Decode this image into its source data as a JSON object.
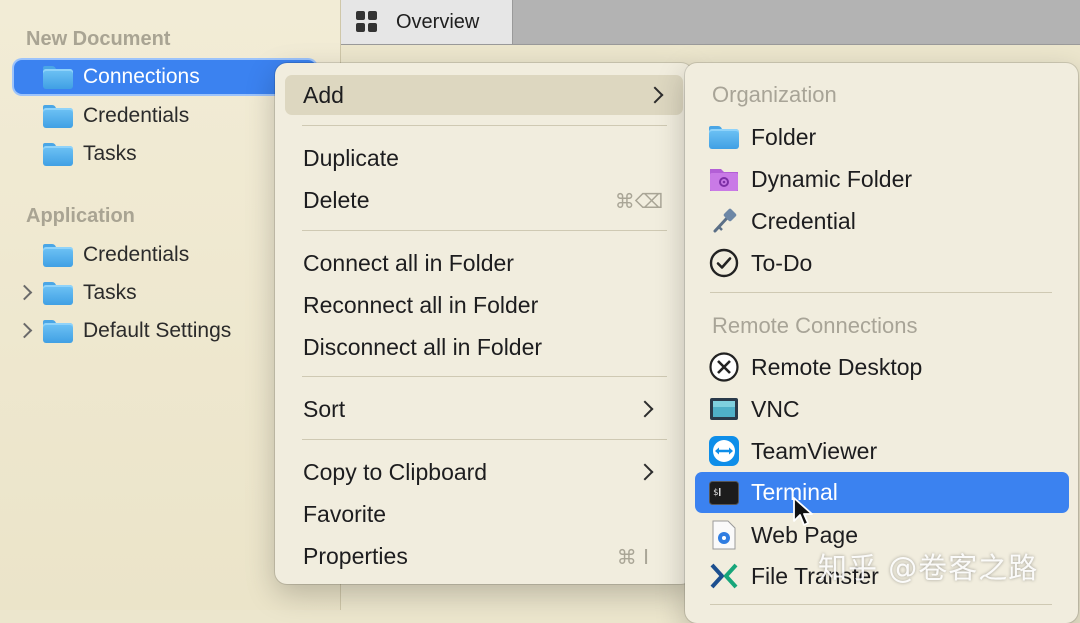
{
  "sidebar": {
    "sections": [
      {
        "header": "New Document",
        "items": [
          {
            "label": "Connections",
            "selected": true
          },
          {
            "label": "Credentials"
          },
          {
            "label": "Tasks"
          }
        ]
      },
      {
        "header": "Application",
        "items": [
          {
            "label": "Credentials"
          },
          {
            "label": "Tasks",
            "expandable": true
          },
          {
            "label": "Default Settings",
            "expandable": true
          }
        ]
      }
    ]
  },
  "tabbar": {
    "tabs": [
      {
        "label": "Overview",
        "icon": "grid-icon",
        "active": true
      }
    ]
  },
  "context_menu": {
    "add": "Add",
    "duplicate": "Duplicate",
    "delete": "Delete",
    "delete_shortcut": "⌘⌫",
    "connect_all": "Connect all in Folder",
    "reconnect_all": "Reconnect all in Folder",
    "disconnect_all": "Disconnect all in Folder",
    "sort": "Sort",
    "copy_to_clipboard": "Copy to Clipboard",
    "favorite": "Favorite",
    "properties": "Properties",
    "properties_shortcut": "⌘ I"
  },
  "add_submenu": {
    "organization": {
      "header": "Organization",
      "items": [
        {
          "label": "Folder",
          "icon": "folder-icon"
        },
        {
          "label": "Dynamic Folder",
          "icon": "dynamic-folder-icon"
        },
        {
          "label": "Credential",
          "icon": "key-icon"
        },
        {
          "label": "To-Do",
          "icon": "checkmark-circle-icon"
        }
      ]
    },
    "remote": {
      "header": "Remote Connections",
      "items": [
        {
          "label": "Remote Desktop",
          "icon": "remote-desktop-icon"
        },
        {
          "label": "VNC",
          "icon": "vnc-icon"
        },
        {
          "label": "TeamViewer",
          "icon": "teamviewer-icon"
        },
        {
          "label": "Terminal",
          "icon": "terminal-icon",
          "highlighted": true
        },
        {
          "label": "Web Page",
          "icon": "web-page-icon"
        },
        {
          "label": "File Transfer",
          "icon": "file-transfer-icon"
        }
      ]
    }
  },
  "watermark": "知乎 @卷客之路",
  "colors": {
    "selection": "#3b82f0",
    "menu_background": "#f1edde",
    "sidebar_background": "#efe9d2"
  }
}
